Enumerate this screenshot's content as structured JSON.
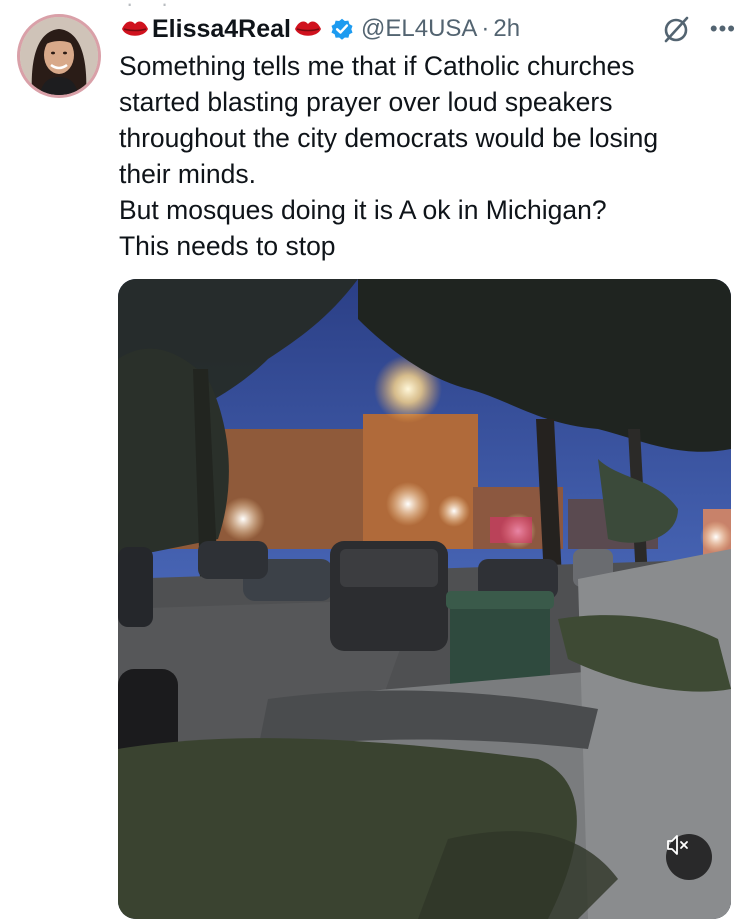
{
  "tweet": {
    "display_name": "Elissa4Real",
    "handle": "@EL4USA",
    "separator": "·",
    "time": "2h",
    "text_lines": [
      "Something tells me that if Catholic churches",
      "started blasting prayer over loud speakers",
      "throughout the city democrats would be losing",
      "their minds.",
      "But mosques doing it is A ok in Michigan?",
      "This needs to stop"
    ],
    "more_glyph": "•••"
  },
  "icons": {
    "lips": "kiss-mark-icon",
    "verified": "verified-badge-icon",
    "grok": "grok-icon",
    "more": "more-options-icon",
    "mute": "muted-speaker-icon"
  },
  "colors": {
    "verified": "#1d9bf0",
    "secondary_text": "#536471",
    "lips": "#d0121e"
  }
}
